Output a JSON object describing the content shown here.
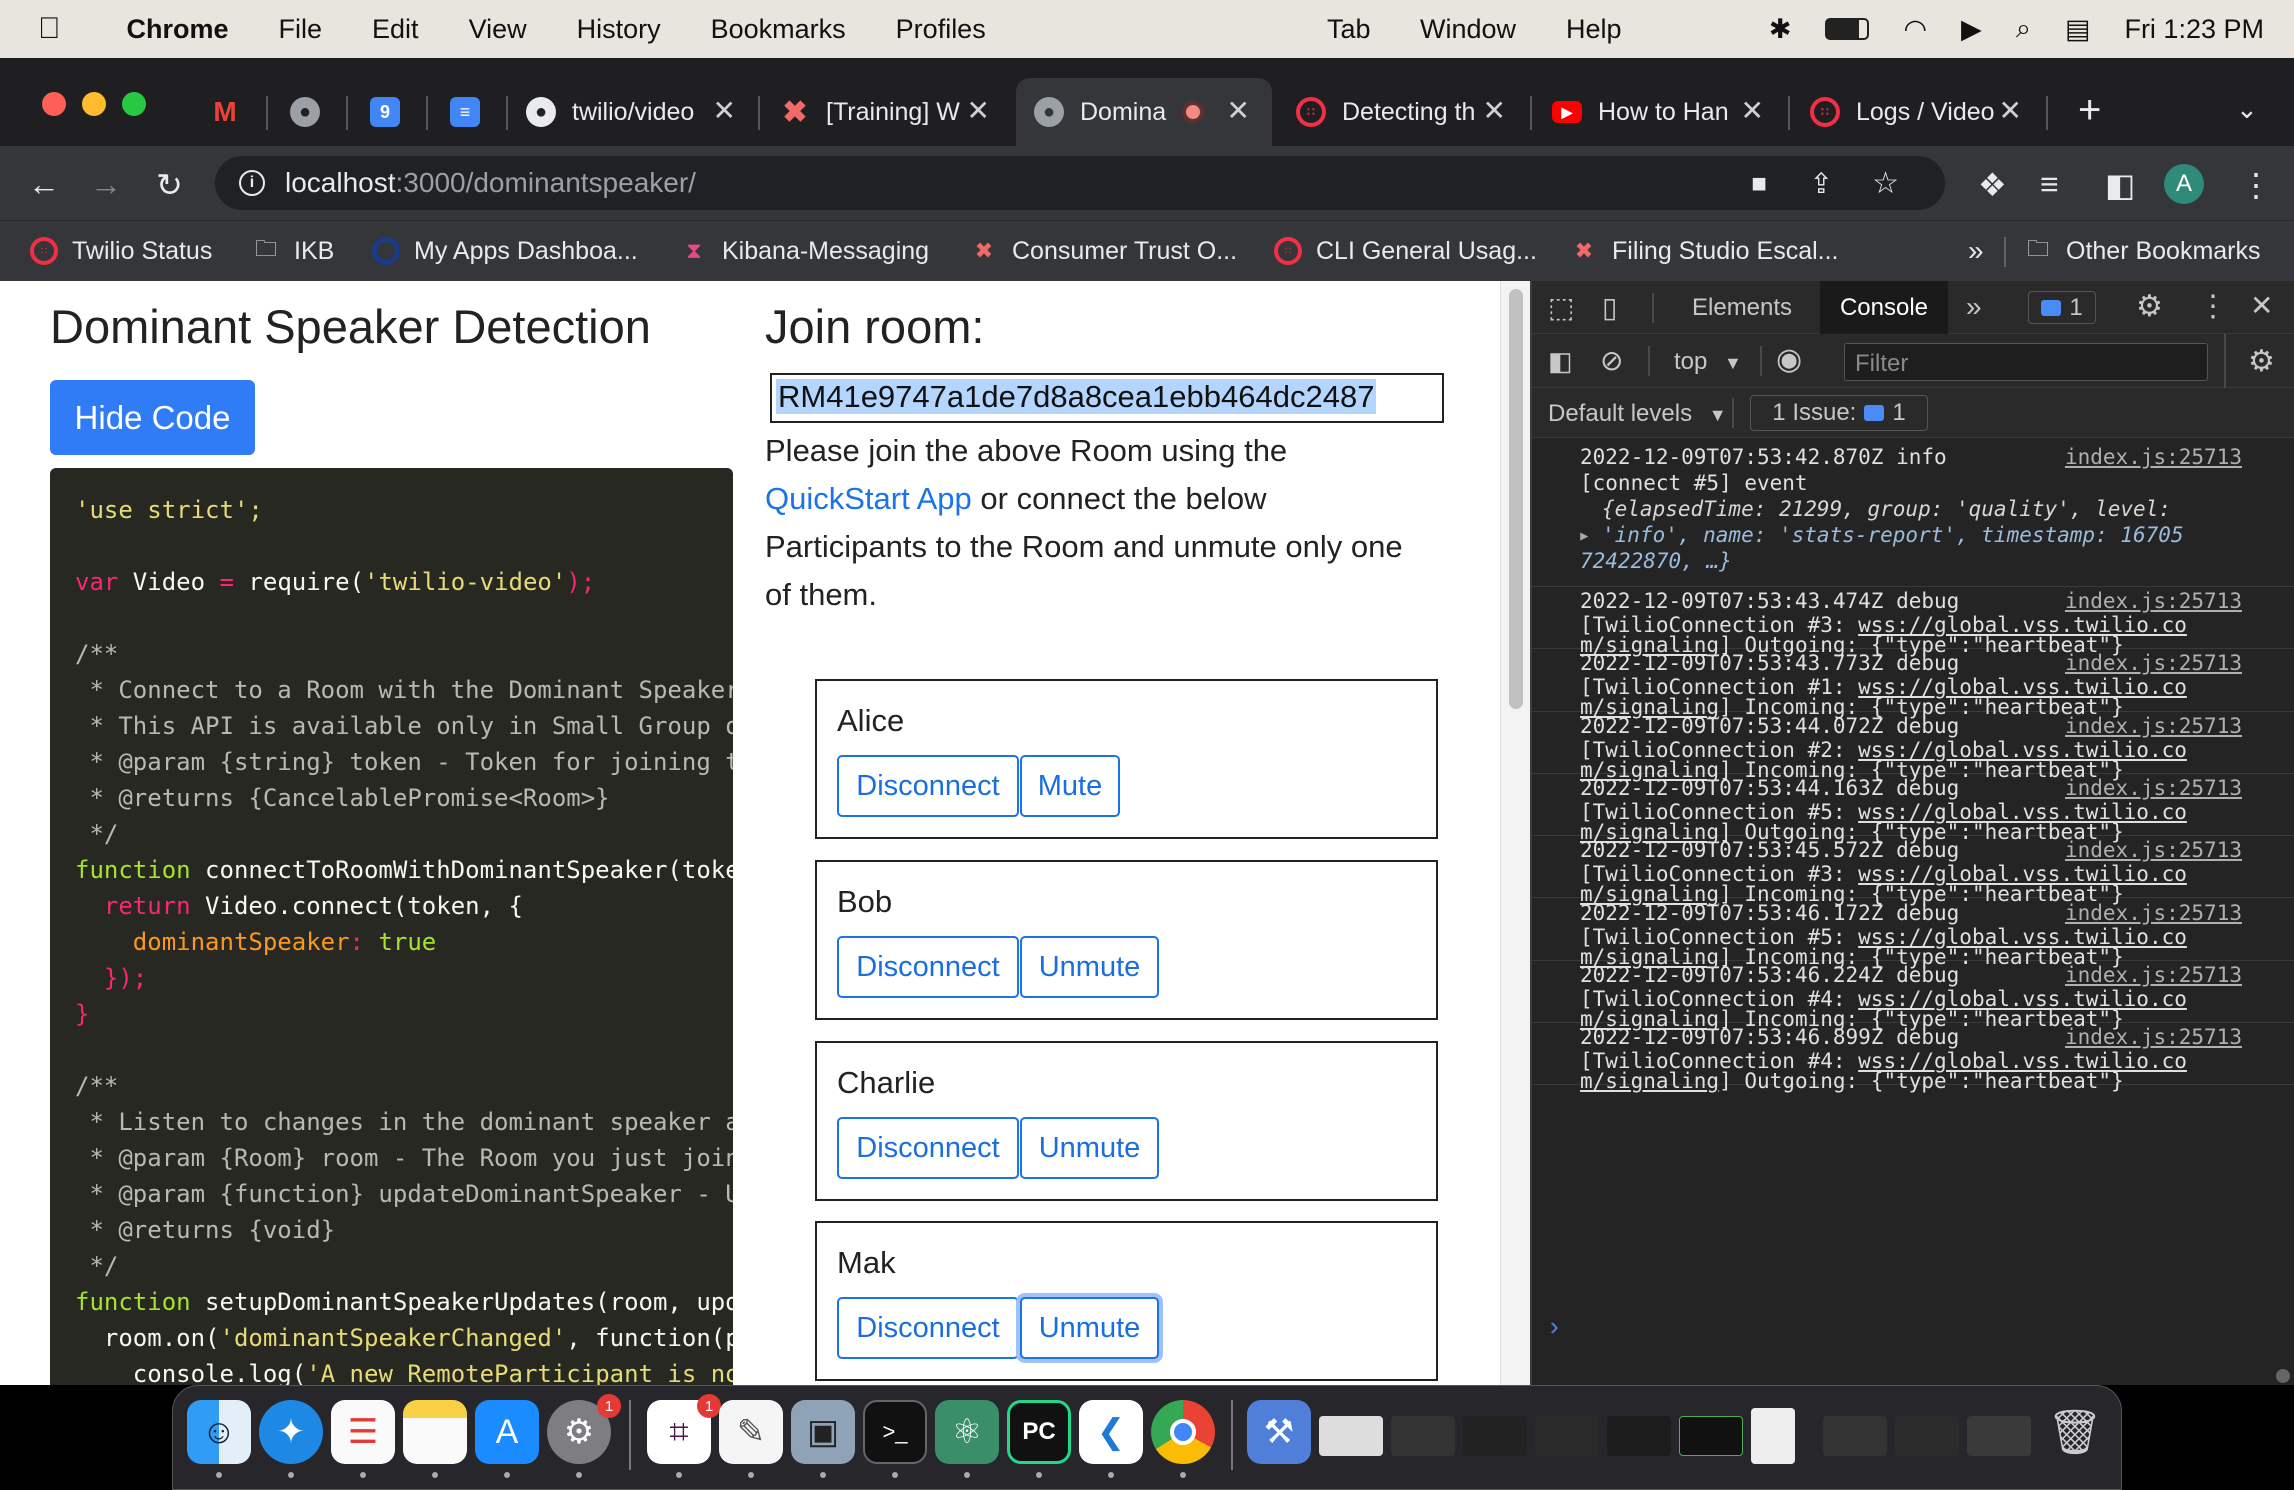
{
  "menubar": {
    "app": "Chrome",
    "items": [
      "File",
      "Edit",
      "View",
      "History",
      "Bookmarks",
      "Profiles"
    ],
    "right_items": [
      "Tab",
      "Window",
      "Help"
    ],
    "clock": "Fri 1:23 PM"
  },
  "tabs": [
    {
      "title": "",
      "icon": "gmail-icon"
    },
    {
      "title": "",
      "icon": "globe-icon"
    },
    {
      "title": "",
      "icon": "calendar-icon"
    },
    {
      "title": "",
      "icon": "docs-icon"
    },
    {
      "title": "twilio/video",
      "icon": "github-icon"
    },
    {
      "title": "[Training] W",
      "icon": "asana-icon"
    },
    {
      "title": "Domina",
      "icon": "globe-icon"
    },
    {
      "title": "Detecting th",
      "icon": "twilio-icon"
    },
    {
      "title": "How to Han",
      "icon": "youtube-icon"
    },
    {
      "title": "Logs / Video",
      "icon": "twilio-icon"
    }
  ],
  "omnibox": {
    "host": "localhost",
    "rest": ":3000/dominantspeaker/"
  },
  "bookmarks": [
    {
      "label": "Twilio Status",
      "icon": "twilio-icon"
    },
    {
      "label": "IKB",
      "icon": "folder-icon"
    },
    {
      "label": "My Apps Dashboa...",
      "icon": "okta-icon"
    },
    {
      "label": "Kibana-Messaging",
      "icon": "kibana-icon"
    },
    {
      "label": "Consumer Trust O...",
      "icon": "asana-icon"
    },
    {
      "label": "CLI General Usag...",
      "icon": "twilio-icon"
    },
    {
      "label": "Filing Studio Escal...",
      "icon": "asana-icon"
    }
  ],
  "bookmarks_overflow": "»",
  "other_bookmarks": "Other Bookmarks",
  "profile_initial": "A",
  "page": {
    "title": "Dominant Speaker Detection",
    "hide_code": "Hide Code",
    "join_title": "Join room:",
    "room_sid": "RM41e9747a1de7d8a8cea1ebb464dc2487",
    "instructions_1": "Please join the above Room using the",
    "quickstart_link": "QuickStart App",
    "instructions_2": " or connect the below",
    "instructions_3": "Participants to the Room and unmute only one",
    "instructions_4": "of them.",
    "participants": [
      {
        "name": "Alice",
        "disconnect": "Disconnect",
        "toggle": "Mute"
      },
      {
        "name": "Bob",
        "disconnect": "Disconnect",
        "toggle": "Unmute"
      },
      {
        "name": "Charlie",
        "disconnect": "Disconnect",
        "toggle": "Unmute"
      },
      {
        "name": "Mak",
        "disconnect": "Disconnect",
        "toggle": "Unmute"
      }
    ]
  },
  "code": {
    "l1": "'use strict';",
    "l3a": "var",
    "l3b": " Video ",
    "l3c": "=",
    "l3d": " require(",
    "l3e": "'twilio-video'",
    "l3f": ");",
    "l5": "/**",
    "l6": " * Connect to a Room with the Dominant Speaker",
    "l7": " * This API is available only in Small Group o",
    "l8": " * @param {string} token - Token for joining t",
    "l9": " * @returns {CancelablePromise<Room>}",
    "l10": " */",
    "l11a": "function",
    "l11b": " connectToRoomWithDominantSpeaker",
    "l11c": "(toke",
    "l12a": "  return",
    "l12b": " Video",
    "l12c": ".connect(token, {",
    "l13a": "    dominantSpeaker",
    "l13b": ":",
    "l13c": " true",
    "l14": "  });",
    "l15": "}",
    "l17": "/**",
    "l18": " * Listen to changes in the dominant speaker a",
    "l19": " * @param {Room} room - The Room you just join",
    "l20": " * @param {function} updateDominantSpeaker - U",
    "l21": " * @returns {void}",
    "l22": " */",
    "l23a": "function",
    "l23b": " setupDominantSpeakerUpdates",
    "l23c": "(room, upd",
    "l24a": "  room",
    "l24b": ".on(",
    "l24c": "'dominantSpeakerChanged'",
    "l24d": ", function(p",
    "l25a": "    console",
    "l25b": ".log(",
    "l25c": "'A new RemoteParticipant is no"
  },
  "devtools": {
    "tabs": [
      "Elements",
      "Console"
    ],
    "more": "»",
    "badge_count": "1",
    "context": "top",
    "filter_placeholder": "Filter",
    "levels": "Default levels",
    "issues": "1 Issue:",
    "issues_count": "1",
    "first_log": {
      "line1": "2022-12-09T07:53:42.870Z info",
      "source": "index.js:25713",
      "line2": "[connect #5] event",
      "line3": "{elapsedTime: 21299, group: 'quality', level:",
      "line4": "'info', name: 'stats-report', timestamp: 16705",
      "line5": "72422870, …}"
    },
    "logs": [
      {
        "ts": "2022-12-09T07:53:43.474Z debug",
        "conn": "[TwilioConnection #3: ",
        "dir": "Outgoing"
      },
      {
        "ts": "2022-12-09T07:53:43.773Z debug",
        "conn": "[TwilioConnection #1: ",
        "dir": "Incoming"
      },
      {
        "ts": "2022-12-09T07:53:44.072Z debug",
        "conn": "[TwilioConnection #2: ",
        "dir": "Incoming"
      },
      {
        "ts": "2022-12-09T07:53:44.163Z debug",
        "conn": "[TwilioConnection #5: ",
        "dir": "Outgoing"
      },
      {
        "ts": "2022-12-09T07:53:45.572Z debug",
        "conn": "[TwilioConnection #3: ",
        "dir": "Incoming"
      },
      {
        "ts": "2022-12-09T07:53:46.172Z debug",
        "conn": "[TwilioConnection #5: ",
        "dir": "Incoming"
      },
      {
        "ts": "2022-12-09T07:53:46.224Z debug",
        "conn": "[TwilioConnection #4: ",
        "dir": "Incoming"
      },
      {
        "ts": "2022-12-09T07:53:46.899Z debug",
        "conn": "[TwilioConnection #4: ",
        "dir": "Outgoing"
      }
    ],
    "log_source": "index.js:25713",
    "wss_1": "wss://global.vss.twilio.co",
    "wss_2": "m/signaling",
    "payload": ": {\"type\":\"heartbeat\"}",
    "prompt": "›"
  },
  "dock": {
    "badges": {
      "settings": "1",
      "slack": "1"
    }
  }
}
